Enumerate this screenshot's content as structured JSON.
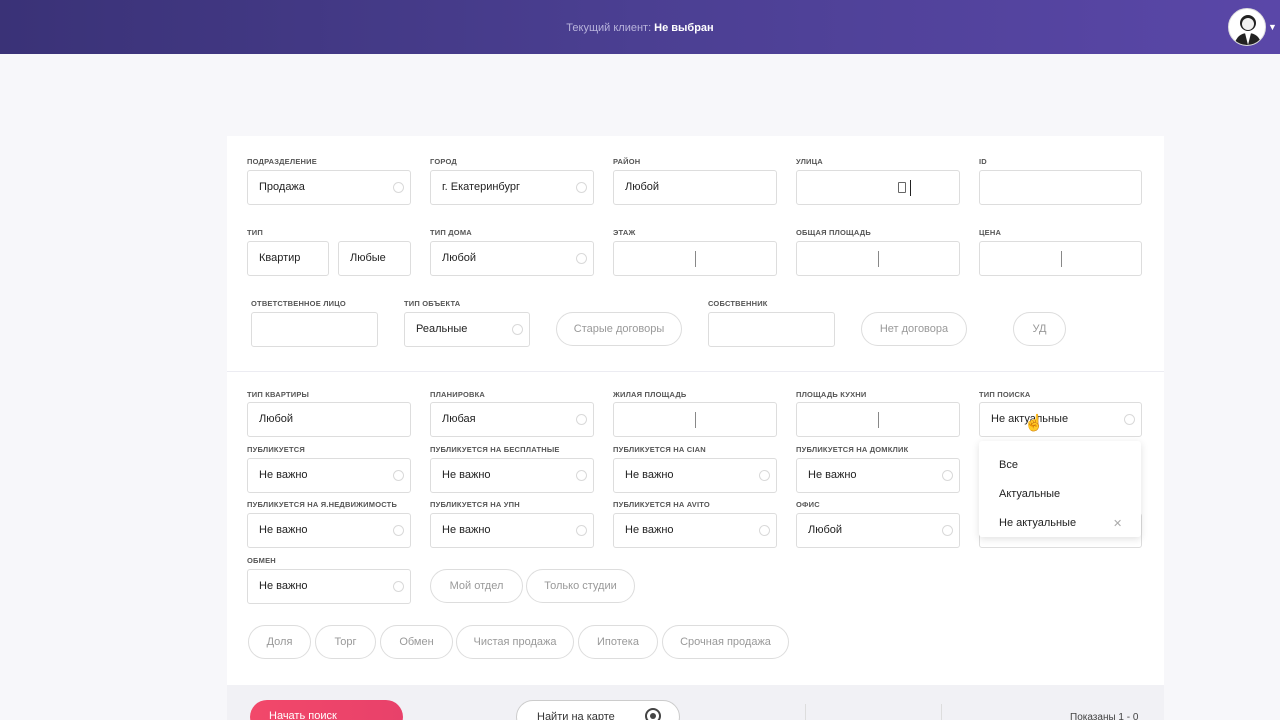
{
  "header": {
    "client_label": "Текущий клиент:",
    "client_value": "Не выбран"
  },
  "row1": {
    "division": {
      "label": "Подразделение",
      "value": "Продажа"
    },
    "city": {
      "label": "Город",
      "value": "г. Екатеринбург"
    },
    "district": {
      "label": "Район",
      "value": "Любой"
    },
    "street": {
      "label": "Улица",
      "value": ""
    },
    "id": {
      "label": "ID",
      "value": ""
    }
  },
  "row2": {
    "type": {
      "label": "Тип",
      "value1": "Квартир",
      "value2": "Любые"
    },
    "house_type": {
      "label": "Тип дома",
      "value": "Любой"
    },
    "floor": {
      "label": "Этаж"
    },
    "total_area": {
      "label": "Общая площадь"
    },
    "price": {
      "label": "Цена"
    }
  },
  "row3": {
    "responsible": {
      "label": "Ответственное лицо",
      "value": ""
    },
    "object_type": {
      "label": "Тип объекта",
      "value": "Реальные"
    },
    "old_contracts": "Старые договоры",
    "owner": {
      "label": "Собственник",
      "value": ""
    },
    "no_contract": "Нет договора",
    "ud": "УД"
  },
  "row4": {
    "apt_type": {
      "label": "Тип квартиры",
      "value": "Любой"
    },
    "layout": {
      "label": "Планировка",
      "value": "Любая"
    },
    "living_area": {
      "label": "Жилая площадь"
    },
    "kitchen_area": {
      "label": "Площадь кухни"
    },
    "search_type": {
      "label": "Тип поиска",
      "value": "Не актуальные"
    }
  },
  "row5": {
    "published": {
      "label": "Публикуется",
      "value": "Не важно"
    },
    "published_free": {
      "label": "Публикуется на бесплатные",
      "value": "Не важно"
    },
    "published_cian": {
      "label": "Публикуется на CIAN",
      "value": "Не важно"
    },
    "published_domclick": {
      "label": "Публикуется на Домклик",
      "value": "Не важно"
    }
  },
  "row6": {
    "published_yandex": {
      "label": "Публикуется на Я.Недвижимость",
      "value": "Не важно"
    },
    "published_upn": {
      "label": "Публикуется на УПН",
      "value": "Не важно"
    },
    "published_avito": {
      "label": "Публикуется на AVITO",
      "value": "Не важно"
    },
    "office": {
      "label": "Офис",
      "value": "Любой"
    }
  },
  "row7": {
    "exchange": {
      "label": "Обмен",
      "value": "Не важно"
    },
    "my_department": "Мой отдел",
    "studios_only": "Только студии"
  },
  "tags": [
    "Доля",
    "Торг",
    "Обмен",
    "Чистая продажа",
    "Ипотека",
    "Срочная продажа"
  ],
  "dropdown": {
    "options": [
      "Все",
      "Актуальные",
      "Не актуальные"
    ],
    "selected": "Не актуальные"
  },
  "footer": {
    "start_search": "Начать поиск",
    "find_on_map": "Найти на карте",
    "shown": "Показаны 1 - 0"
  }
}
